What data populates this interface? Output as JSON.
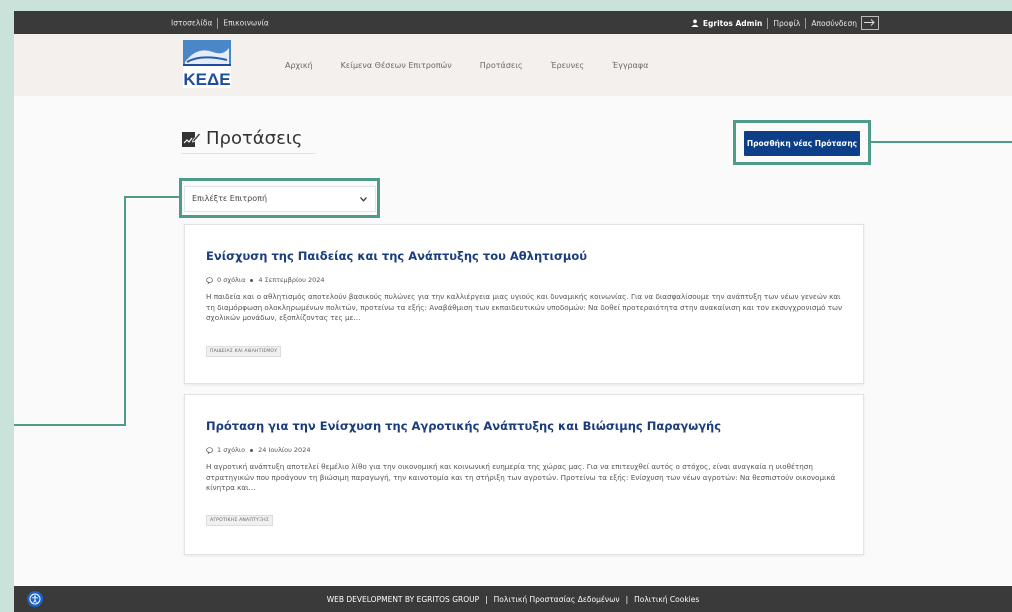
{
  "topbar": {
    "left_links": [
      "Ιστοσελίδα",
      "Επικοινωνία"
    ],
    "user": "Egritos Admin",
    "profile": "Προφίλ",
    "logout": "Αποσύνδεση"
  },
  "nav": {
    "logo_text": "ΚΕΔΕ",
    "items": [
      "Αρχική",
      "Κείμενα Θέσεων Επιτροπών",
      "Προτάσεις",
      "Έρευνες",
      "Έγγραφα"
    ]
  },
  "page": {
    "title": "Προτάσεις",
    "add_button": "Προσθήκη νέας Πρότασης",
    "dropdown_selected": "Επιλέξτε Επιτροπή"
  },
  "posts": [
    {
      "title": "Ενίσχυση της Παιδείας και της Ανάπτυξης του Αθλητισμού",
      "comments": "0 σχόλια",
      "date": "4 Σεπτεμβρίου 2024",
      "excerpt": "Η παιδεία και ο αθλητισμός αποτελούν βασικούς πυλώνες για την καλλιέργεια μιας υγιούς και δυναμικής κοινωνίας. Για να διασφαλίσουμε την ανάπτυξη των νέων γενεών και τη διαμόρφωση ολοκληρωμένων πολιτών, προτείνω τα εξής: Αναβάθμιση των εκπαιδευτικών υποδομών: Να δοθεί προτεραιότητα στην ανακαίνιση και τον εκσυγχρονισμό των σχολικών μονάδων, εξοπλίζοντας τες με…",
      "tag": "ΠΑΙΔΕΙΑΣ ΚΑΙ ΑΘΛΗΤΙΣΜΟΥ"
    },
    {
      "title": "Πρόταση για την Ενίσχυση της Αγροτικής Ανάπτυξης και Βιώσιμης Παραγωγής",
      "comments": "1 σχόλιο",
      "date": "24 Ιουλίου 2024",
      "excerpt": "Η αγροτική ανάπτυξη αποτελεί θεμέλιο λίθο για την οικονομική και κοινωνική ευημερία της χώρας μας. Για να επιτευχθεί αυτός ο στόχος, είναι αναγκαία η υιοθέτηση στρατηγικών που προάγουν τη βιώσιμη παραγωγή, την καινοτομία και τη στήριξη των αγροτών. Προτείνω τα εξής: Ενίσχυση των νέων αγροτών: Να θεσπιστούν οικονομικά κίνητρα και…",
      "tag": "ΑΓΡΟΤΙΚΗΣ ΑΝΑΠΤΥΞΗΣ"
    }
  ],
  "footer": {
    "credit": "WEB DEVELOPMENT BY EGRITOS GROUP",
    "privacy": "Πολιτική Προστασίας Δεδομένων",
    "cookies": "Πολιτική Cookies"
  },
  "colors": {
    "accent": "#0d3f88",
    "highlight": "#4f9a88",
    "bar": "#3a3a3a"
  }
}
